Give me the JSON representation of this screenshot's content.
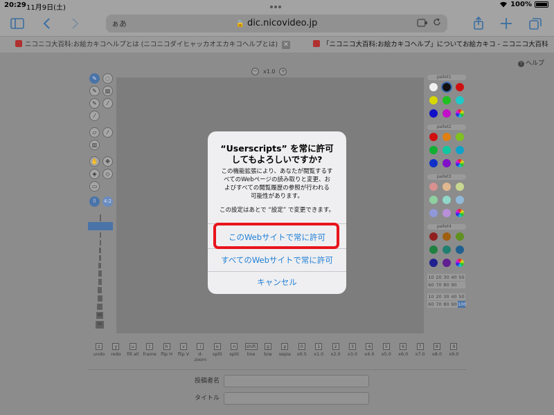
{
  "status": {
    "time": "20:29",
    "date": "11月9日(土)",
    "battery": "100%"
  },
  "browser": {
    "address_prefix": "ぁあ",
    "url": "dic.nicovideo.jp",
    "tabs": [
      {
        "title": "ニコニコ大百科:お絵カキコヘルプとは (ニコニコダイヒャッカオエカキコヘルプとは) [単語..."
      },
      {
        "title": "「ニコニコ大百科:お絵カキコヘルプ」についてお絵カキコ - ニコニコ大百科"
      }
    ],
    "tab_close_glyph": "✕"
  },
  "page": {
    "help_label": "ヘルプ",
    "zoom_label": "x1.0",
    "zoom_out_glyph": "－",
    "zoom_in_glyph": "＋",
    "size_buttons": {
      "grid": "⠿",
      "label": "4:2"
    },
    "size_labels": [
      "40",
      "50"
    ],
    "palettes": [
      {
        "label": "pallet1",
        "colors": [
          "#f0f0f0",
          "#111111",
          "#d01010",
          "#d8d800",
          "#20c020",
          "#20c8c8",
          "#1010c8",
          "#c010c8",
          "#multi"
        ]
      },
      {
        "label": "pallet2",
        "colors": [
          "#d01010",
          "#e08010",
          "#80c020",
          "#10b030",
          "#10c8a0",
          "#10a0c8",
          "#1030c8",
          "#8010c8",
          "#multi"
        ]
      },
      {
        "label": "pallet3",
        "colors": [
          "#d89090",
          "#e0b890",
          "#c8d890",
          "#90d0a0",
          "#90d8c8",
          "#90b8d8",
          "#9098d8",
          "#b890d8",
          "#multi"
        ]
      },
      {
        "label": "pallet4",
        "colors": [
          "#902020",
          "#a06010",
          "#609020",
          "#208040",
          "#208070",
          "#206090",
          "#202090",
          "#602090",
          "#multi"
        ]
      }
    ],
    "opacity_grid_1": [
      "10",
      "20",
      "30",
      "40",
      "50",
      "60",
      "70",
      "80",
      "90",
      ""
    ],
    "opacity_grid_2": [
      "10",
      "20",
      "30",
      "40",
      "50",
      "60",
      "70",
      "80",
      "90",
      "100"
    ],
    "keys": [
      {
        "k": "z",
        "l": "undo"
      },
      {
        "k": "y",
        "l": "redo"
      },
      {
        "k": "u",
        "l": "fill all"
      },
      {
        "k": "t",
        "l": "frame"
      },
      {
        "k": "h",
        "l": "flip H"
      },
      {
        "k": "v",
        "l": "flip V"
      },
      {
        "k": "i",
        "l": "d-zoom"
      },
      {
        "k": "o",
        "l": "split"
      },
      {
        "k": "n",
        "l": "split"
      },
      {
        "k": "shift",
        "l": "line"
      },
      {
        "k": "g",
        "l": "b/w"
      },
      {
        "k": "p",
        "l": "sepia"
      },
      {
        "k": "0",
        "l": "x0.5"
      },
      {
        "k": "1",
        "l": "x1.0"
      },
      {
        "k": "2",
        "l": "x2.0"
      },
      {
        "k": "3",
        "l": "x3.0"
      },
      {
        "k": "4",
        "l": "x4.0"
      },
      {
        "k": "5",
        "l": "x5.0"
      },
      {
        "k": "6",
        "l": "x6.0"
      },
      {
        "k": "7",
        "l": "x7.0"
      },
      {
        "k": "8",
        "l": "x8.0"
      },
      {
        "k": "9",
        "l": "x9.0"
      }
    ],
    "form": {
      "poster_label": "投稿者名",
      "title_label": "タイトル"
    }
  },
  "dialog": {
    "title_line1": "“Userscripts” を常に許可",
    "title_line2": "してもよろしいですか?",
    "body_lines": [
      "この機能拡張により、あなたが閲覧するす",
      "べてのWebページの読み取りと変更、お",
      "よびすべての閲覧履歴の参照が行われる",
      "可能性があります。"
    ],
    "note": "この設定はあとで “設定” で変更できます。",
    "btn_this_site": "このWebサイトで常に許可",
    "btn_all_sites": "すべてのWebサイトで常に許可",
    "btn_cancel": "キャンセル"
  }
}
